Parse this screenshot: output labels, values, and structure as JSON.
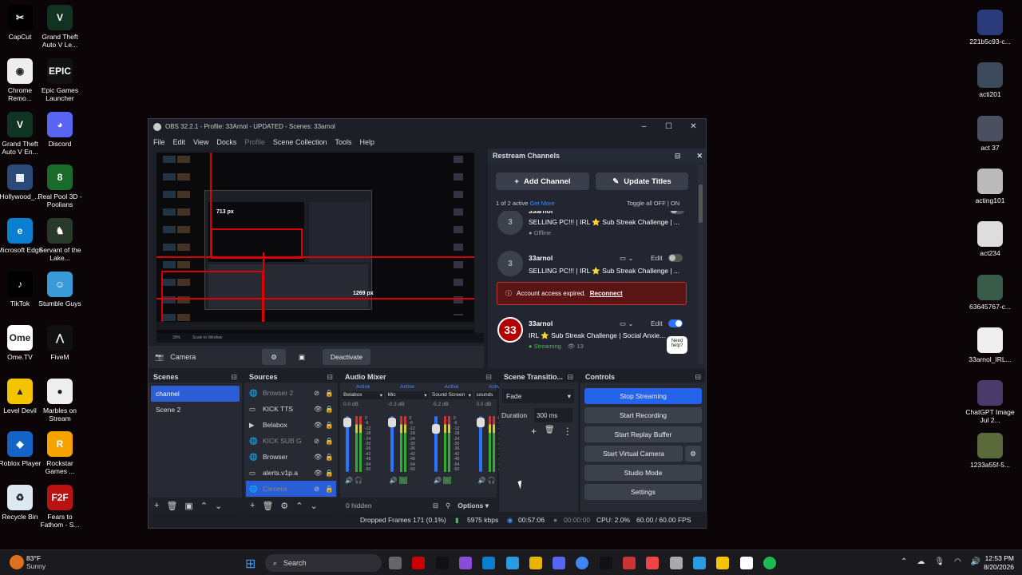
{
  "desktop_left": [
    {
      "label": "CapCut",
      "color": "#000",
      "glyph": "✂"
    },
    {
      "label": "Grand Theft Auto V Le...",
      "color": "#132",
      "glyph": "V"
    },
    {
      "label": "Chrome Remo...",
      "color": "#eee",
      "glyph": "◉"
    },
    {
      "label": "Epic Games Launcher",
      "color": "#111",
      "glyph": "EPIC"
    },
    {
      "label": "Grand Theft Auto V En...",
      "color": "#132",
      "glyph": "V"
    },
    {
      "label": "Discord",
      "color": "#5865f2",
      "glyph": "◕"
    },
    {
      "label": "Hollywood_...",
      "color": "#2b4a7a",
      "glyph": "▦"
    },
    {
      "label": "Real Pool 3D - Poolians",
      "color": "#1a6a2a",
      "glyph": "8"
    },
    {
      "label": "Microsoft Edge",
      "color": "#0a7fcf",
      "glyph": "e"
    },
    {
      "label": "Servant of the Lake...",
      "color": "#2a3a2a",
      "glyph": "♞"
    },
    {
      "label": "TikTok",
      "color": "#000",
      "glyph": "♪"
    },
    {
      "label": "Stumble Guys",
      "color": "#3a9ad9",
      "glyph": "☺"
    },
    {
      "label": "Ome.TV",
      "color": "#fff",
      "glyph": "Ome"
    },
    {
      "label": "FiveM",
      "color": "#111",
      "glyph": "⋀"
    },
    {
      "label": "Level Devil",
      "color": "#f5c400",
      "glyph": "▲"
    },
    {
      "label": "Marbles on Stream",
      "color": "#eee",
      "glyph": "●"
    },
    {
      "label": "Roblox Player",
      "color": "#1463c6",
      "glyph": "◆"
    },
    {
      "label": "Rockstar Games ...",
      "color": "#f6a200",
      "glyph": "R"
    },
    {
      "label": "Recycle Bin",
      "color": "#dde8f0",
      "glyph": "♻"
    },
    {
      "label": "Fears to Fathom - S...",
      "color": "#b11",
      "glyph": "F2F"
    }
  ],
  "desktop_right": [
    {
      "label": "221b5c93-c...",
      "color": "#2a3a7a"
    },
    {
      "label": "acti201",
      "color": "#3a4a5a"
    },
    {
      "label": "act 37",
      "color": "#4a5060"
    },
    {
      "label": "acting101",
      "color": "#bbb"
    },
    {
      "label": "act234",
      "color": "#ddd"
    },
    {
      "label": "63645767-c...",
      "color": "#3a5a4a"
    },
    {
      "label": "33arnol_IRL...",
      "color": "#eee"
    },
    {
      "label": "ChatGPT Image Jul 2...",
      "color": "#4a3a6a"
    },
    {
      "label": "1233a55f-5...",
      "color": "#5a6a3a"
    }
  ],
  "obs": {
    "title": "OBS 32.2.1 - Profile: 33Arnol - UPDATED - Scenes: 33arnol",
    "menu": [
      "File",
      "Edit",
      "View",
      "Docks",
      "Profile",
      "Scene Collection",
      "Tools",
      "Help"
    ],
    "preview_labels": {
      "width": "713 px",
      "height": "1269 px"
    },
    "zoom": {
      "pct": "30%",
      "mode": "Scale to Window"
    },
    "camera_label": "Camera",
    "deactivate": "Deactivate",
    "restream": {
      "title": "Restream Channels",
      "add_channel": "Add Channel",
      "update_titles": "Update Titles",
      "active_count": "1 of 2 active",
      "get_more": "Get More",
      "toggle_all": "Toggle all",
      "off": "OFF",
      "on": "ON",
      "edit": "Edit",
      "ch1": {
        "avatar": "3",
        "name": "33arnol",
        "title": "SELLING PC!!! | IRL ⭐ Sub Streak Challenge | ...",
        "status": "Offline"
      },
      "ch2": {
        "avatar": "3",
        "name": "33arnol",
        "title": "SELLING PC!!! | IRL ⭐ Sub Streak Challenge | ..."
      },
      "alert": "Account access expired.",
      "reconnect": "Reconnect",
      "ch3": {
        "avatar": "33",
        "name": "33arnol",
        "title": "IRL ⭐ Sub Streak Challenge | Social Anxie...",
        "status": "Streaming",
        "viewers": "13"
      },
      "need_help": "Need help?"
    },
    "scenes": {
      "title": "Scenes",
      "items": [
        "channel",
        "Scene 2"
      ]
    },
    "sources": {
      "title": "Sources",
      "items": [
        "Browser 2",
        "KICK TTS",
        "Belabox",
        "KICK SUB G",
        "Browser",
        "alerts.v1p.a",
        "Camera"
      ]
    },
    "mixer": {
      "title": "Audio Mixer",
      "active": "Active",
      "channels": [
        {
          "name": "Belabox",
          "db": "0.0 dB"
        },
        {
          "name": "Mic",
          "db": "-0.3 dB"
        },
        {
          "name": "Sound Screen",
          "db": "-5.2 dB"
        },
        {
          "name": "sounds",
          "db": "0.0 dB"
        }
      ],
      "scale": [
        "0",
        "-6",
        "-12",
        "-18",
        "-24",
        "-30",
        "-36",
        "-42",
        "-48",
        "-54",
        "-60"
      ],
      "hidden": "0 hidden",
      "options": "Options"
    },
    "transitions": {
      "title": "Scene Transitio...",
      "type": "Fade",
      "duration_label": "Duration",
      "duration": "300 ms"
    },
    "controls": {
      "title": "Controls",
      "items": [
        "Stop Streaming",
        "Start Recording",
        "Start Replay Buffer",
        "Start Virtual Camera",
        "Studio Mode",
        "Settings"
      ]
    },
    "status": {
      "dropped": "Dropped Frames 171 (0.1%)",
      "kbps": "5975 kbps",
      "live_time": "00:57:06",
      "rec_time": "00:00:00",
      "cpu": "CPU: 2.0%",
      "fps": "60.00 / 60.00 FPS"
    }
  },
  "taskbar": {
    "temp": "83°F",
    "weather": "Sunny",
    "search": "Search",
    "time": "12:53 PM",
    "date": "8/20/2026"
  },
  "colors": {
    "accent": "#2c74ff",
    "stream_btn": "#2563eb",
    "alert": "#5a1414",
    "live_green": "#3fbf4a"
  }
}
